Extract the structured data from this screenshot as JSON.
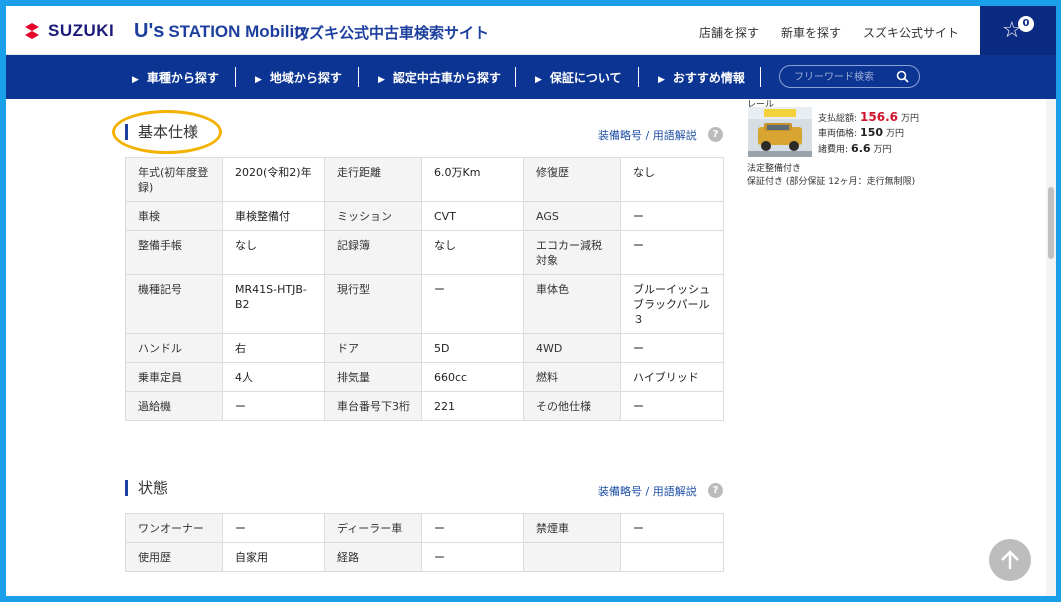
{
  "header": {
    "brand": "SUZUKI",
    "station_us": "U's",
    "station_name": "STATION Mobility",
    "site_name": "スズキ公式中古車検索サイト",
    "links": [
      "店舗を探す",
      "新車を探す",
      "スズキ公式サイト"
    ],
    "favorite_count": "0"
  },
  "nav": {
    "items": [
      "車種から探す",
      "地域から探す",
      "認定中古車から探す",
      "保証について",
      "おすすめ情報"
    ],
    "search_placeholder": "フリーワード検索"
  },
  "sections": {
    "spec_title": "基本仕様",
    "state_title": "状態",
    "glossary_link": "装備略号 / 用語解説",
    "help_glyph": "?"
  },
  "spec_rows": [
    [
      "年式(初年度登録)",
      "2020(令和2)年",
      "走行距離",
      "6.0万Km",
      "修復歴",
      "なし"
    ],
    [
      "車検",
      "車検整備付",
      "ミッション",
      "CVT",
      "AGS",
      "ー"
    ],
    [
      "整備手帳",
      "なし",
      "記録簿",
      "なし",
      "エコカー減税対象",
      "ー"
    ],
    [
      "機種記号",
      "MR41S-HTJB-B2",
      "現行型",
      "ー",
      "車体色",
      "ブルーイッシュブラックパール３"
    ],
    [
      "ハンドル",
      "右",
      "ドア",
      "5D",
      "4WD",
      "ー"
    ],
    [
      "乗車定員",
      "4人",
      "排気量",
      "660cc",
      "燃料",
      "ハイブリッド"
    ],
    [
      "過給機",
      "ー",
      "車台番号下3桁",
      "221",
      "その他仕様",
      "ー"
    ]
  ],
  "state_rows": [
    [
      "ワンオーナー",
      "ー",
      "ディーラー車",
      "ー",
      "禁煙車",
      "ー"
    ],
    [
      "使用歴",
      "自家用",
      "経路",
      "ー",
      "",
      ""
    ]
  ],
  "sidebar": {
    "cut_text": "レール",
    "total_label": "支払総額:",
    "total_value": "156.6",
    "vehicle_label": "車両価格:",
    "vehicle_value": "150",
    "fees_label": "諸費用:",
    "fees_value": "6.6",
    "unit": "万円",
    "note1": "法定整備付き",
    "note2": "保証付き (部分保証 12ヶ月：走行無制限)"
  },
  "colors": {
    "nav_bg": "#0b3493",
    "brand_blue": "#1d3f9e",
    "price_red": "#d0142c",
    "highlight": "#f3b200"
  }
}
